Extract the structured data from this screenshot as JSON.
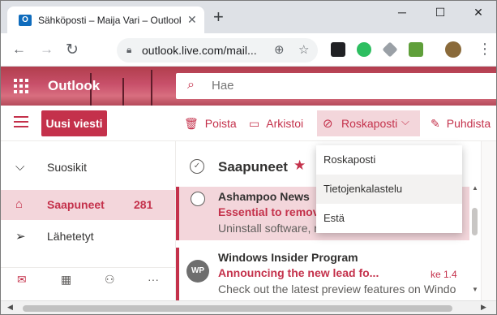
{
  "browser": {
    "tab_title": "Sähköposti – Maija Vari – Outlook",
    "tab_favicon": "O",
    "close_tab": "✕",
    "new_tab": "+",
    "window_minimize": "─",
    "window_maximize": "☐",
    "window_close": "✕",
    "url": "outlook.live.com/mail...",
    "nav_back": "←",
    "nav_forward": "→",
    "nav_reload": "↻"
  },
  "outlook": {
    "brand": "Outlook",
    "search": {
      "placeholder": "Hae",
      "value": "Hae"
    },
    "commands": {
      "new_message": "Uusi viesti",
      "delete": "Poista",
      "archive": "Arkistoi",
      "junk": "Roskaposti",
      "sweep": "Puhdista"
    },
    "junk_menu": [
      "Roskaposti",
      "Tietojenkalastelu",
      "Estä"
    ],
    "nav": {
      "favorites": "Suosikit",
      "inbox": "Saapuneet",
      "inbox_count": "281",
      "sent": "Lähetetyt"
    },
    "folder_title": "Saapuneet",
    "messages": [
      {
        "sender": "Ashampoo News",
        "subject": "Essential to remove",
        "preview": "Uninstall software, r",
        "date": ""
      },
      {
        "sender": "Windows Insider Program",
        "subject": "Announcing the new lead fo...",
        "preview": "Check out the latest preview features on Windo",
        "date": "ke 1.4",
        "avatar": "WP"
      }
    ]
  },
  "colors": {
    "accent": "#c4314b",
    "selected_bg": "#f3d6db"
  },
  "icons": {
    "search": "search-icon",
    "delete": "trash-icon",
    "archive": "archive-icon",
    "junk": "block-icon",
    "sweep": "broom-icon",
    "mail": "mail-icon",
    "calendar": "calendar-icon",
    "people": "people-icon",
    "more": "more-icon"
  }
}
